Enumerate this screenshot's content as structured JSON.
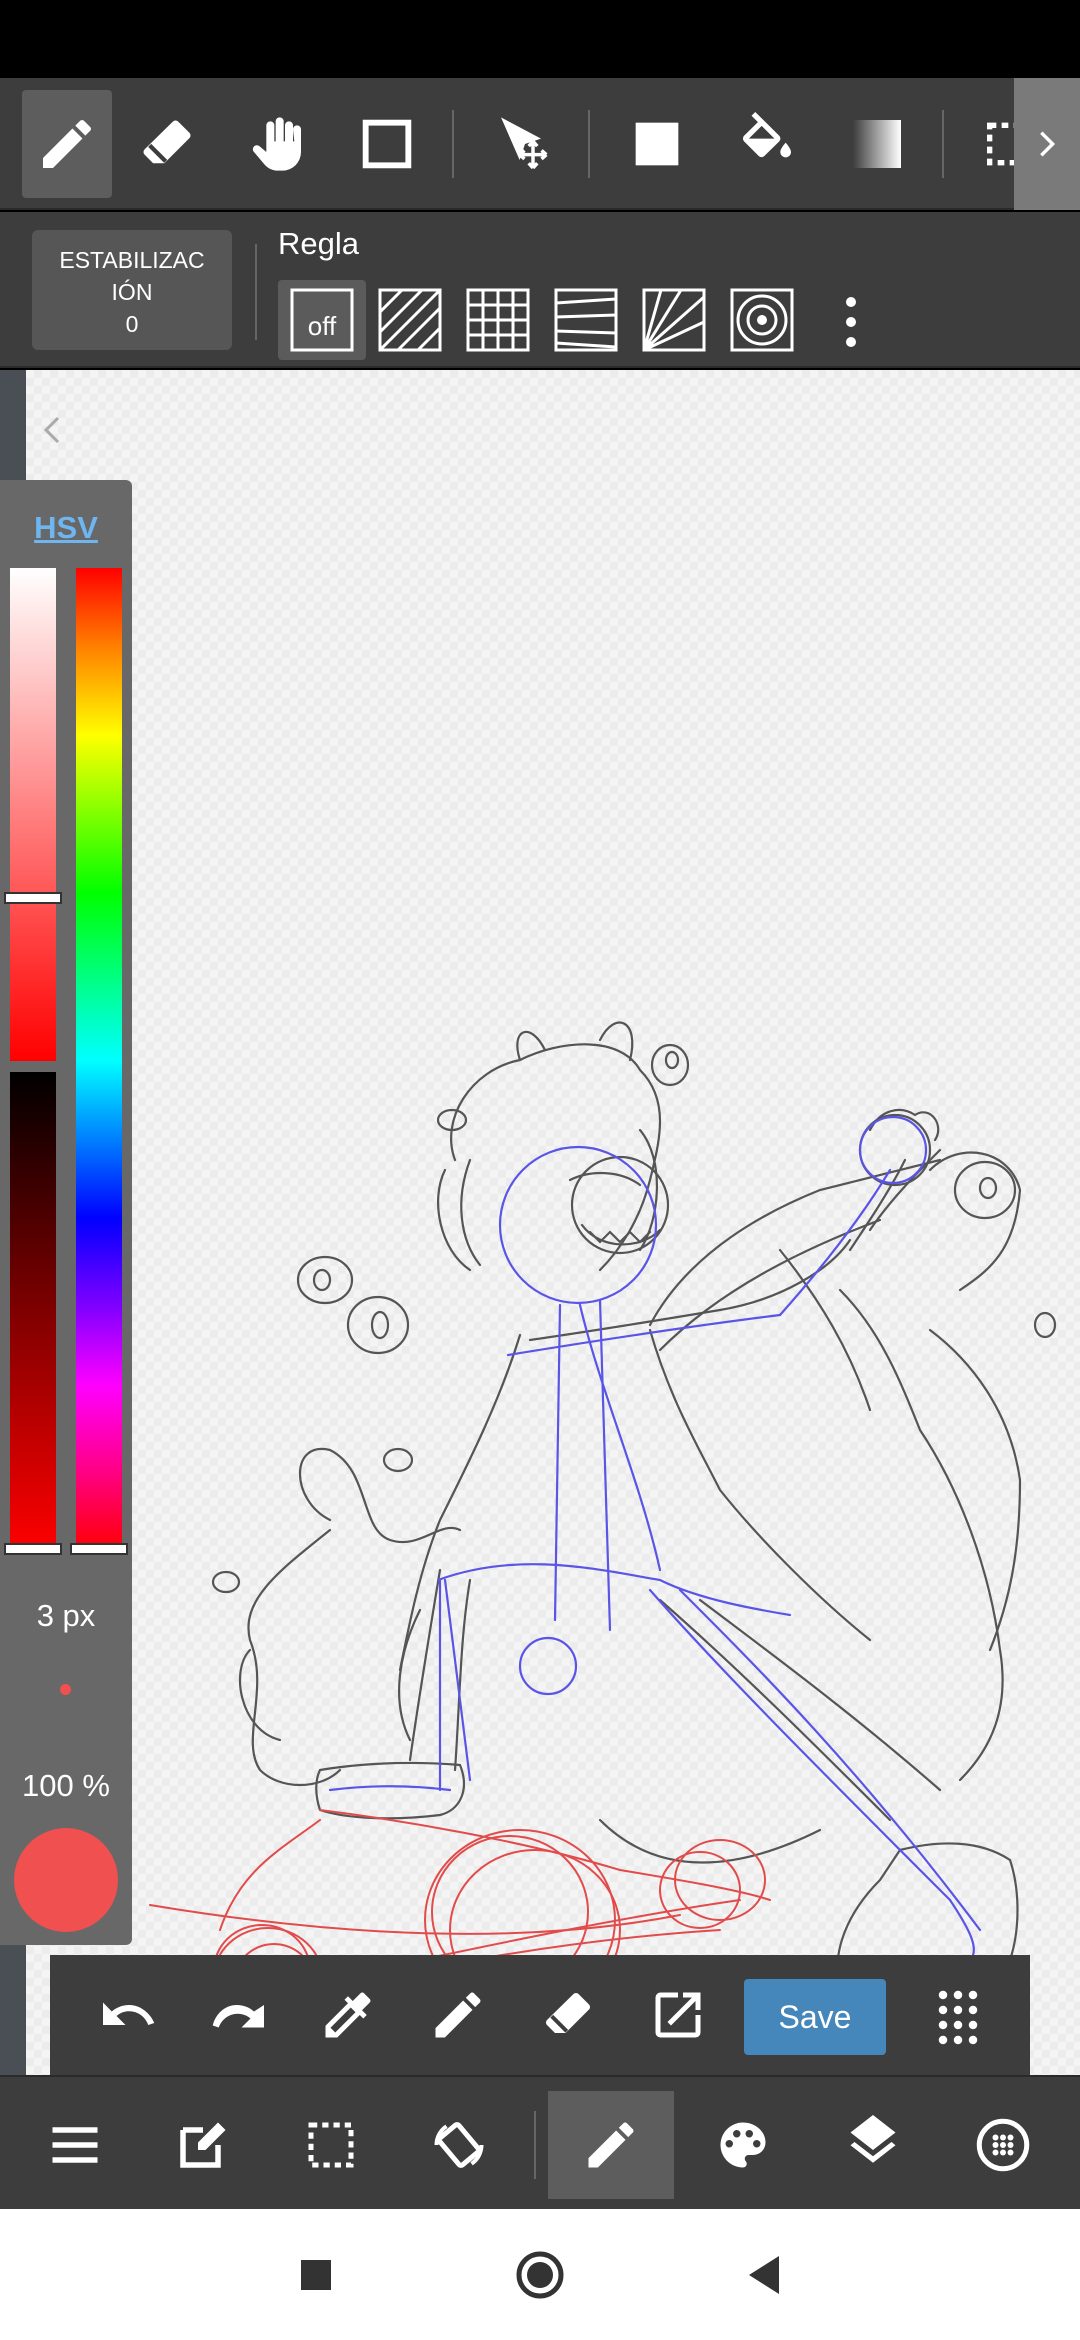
{
  "toolbar": {
    "tools": [
      "pen-icon",
      "eraser-icon",
      "hand-icon",
      "rectangle-icon",
      "move-icon",
      "fill-square-icon",
      "bucket-icon",
      "gradient-icon",
      "select-icon"
    ],
    "active_tool": "pen-icon"
  },
  "stabilizer": {
    "label_line1": "ESTABILIZAC",
    "label_line2": "IÓN",
    "value": "0"
  },
  "ruler": {
    "label": "Regla",
    "off_label": "off",
    "options": [
      "off",
      "parallel-lines",
      "grid",
      "perspective",
      "radial",
      "concentric"
    ]
  },
  "color_panel": {
    "mode_label": "HSV",
    "brush_size": "3 px",
    "opacity": "100 %",
    "current_color": "#f05050",
    "saturation_handle": 0.68,
    "value_handle": 1.0,
    "hue_handle": 1.0
  },
  "quickbar": {
    "save_label": "Save",
    "items": [
      "undo-icon",
      "redo-icon",
      "eyedropper-icon",
      "pen-icon",
      "eraser-icon",
      "transform-icon",
      "grid-icon"
    ]
  },
  "bottombar": {
    "items": [
      "menu-icon",
      "edit-icon",
      "selection-icon",
      "rotate-icon",
      "pen-icon",
      "palette-icon",
      "layers-icon",
      "material-icon"
    ],
    "active": "pen-icon"
  },
  "colors": {
    "toolbar_bg": "#3d3d3d",
    "accent": "#4586bb",
    "sketch_gray": "#555555",
    "sketch_blue": "#5a55e6",
    "sketch_red": "#e24b4b"
  }
}
